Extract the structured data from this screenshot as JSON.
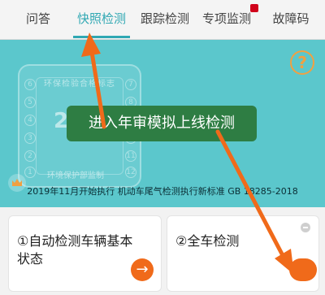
{
  "tabs": [
    {
      "label": "问答",
      "active": false
    },
    {
      "label": "快照检测",
      "active": true
    },
    {
      "label": "跟踪检测",
      "active": false
    },
    {
      "label": "专项监测",
      "active": false,
      "badge": true
    },
    {
      "label": "故障码",
      "active": false
    }
  ],
  "header": {
    "help_symbol": "?",
    "seal": {
      "top_text": "环保检验合格标志",
      "year": "20",
      "bottom_text": "环境保护部监制",
      "numbers": [
        "6",
        "5",
        "4",
        "3",
        "2",
        "1",
        "7",
        "8",
        "9",
        "10",
        "11",
        "12"
      ]
    },
    "callout": "进入年审模拟上线检测",
    "notice": "2019年11月开始执行 机动车尾气检测执行新标准 GB 18285-2018"
  },
  "cards": [
    {
      "title": "①自动检测车辆基本状态",
      "action_symbol": "→"
    },
    {
      "title": "②全车检测"
    }
  ],
  "colors": {
    "accent": "#30a8b3",
    "header_bg": "#5bc7cc",
    "callout_bg": "#2e7d43",
    "orange": "#f06a1a"
  }
}
